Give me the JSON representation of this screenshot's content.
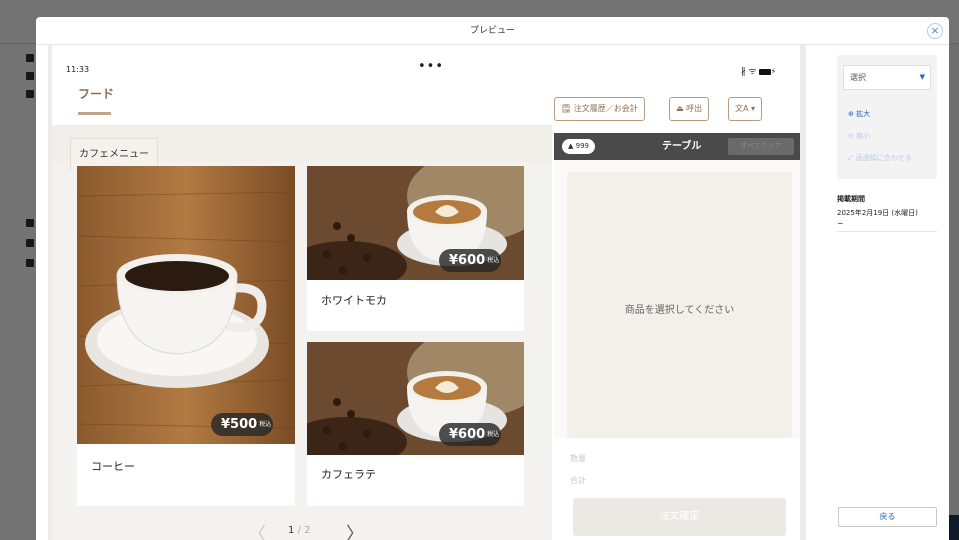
{
  "modal": {
    "title": "プレビュー",
    "close": "×"
  },
  "status": {
    "time": "11:33",
    "dots": "•••",
    "icons": "∦ ᯤ"
  },
  "nav": {
    "food_tab": "フード",
    "category_tab": "カフェメニュー"
  },
  "menu_items": [
    {
      "name": "コーヒー",
      "price": "¥500",
      "tax": "税込"
    },
    {
      "name": "ホワイトモカ",
      "price": "¥600",
      "tax": "税込"
    },
    {
      "name": "カフェラテ",
      "price": "¥600",
      "tax": "税込"
    }
  ],
  "pager": {
    "current": "1",
    "separator": "/",
    "total": "2",
    "prev": "〈",
    "next": "〉"
  },
  "toolbar": {
    "history": "注文履歴／お会計",
    "call": "呼出",
    "lang": "文A"
  },
  "table_bar": {
    "seats": "999",
    "title": "テーブル",
    "clear": "すべてクリア"
  },
  "order": {
    "empty_message": "商品を選択してください",
    "qty_label": "数量",
    "total_label": "合計",
    "confirm": "注文確定"
  },
  "side": {
    "select_value": "選択",
    "zoom_in": "拡大",
    "zoom_out": "縮小",
    "fit": "画面幅に合わせる",
    "period_label": "掲載期間",
    "period_value": "2025年2月19日 (水曜日)",
    "period_tilde": "~",
    "back": "戻る"
  },
  "colors": {
    "accent_brown": "#8c6f57",
    "link_blue": "#2a63c8",
    "table_bar": "#4a4a4a"
  }
}
